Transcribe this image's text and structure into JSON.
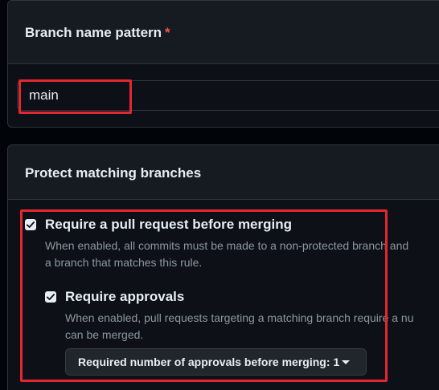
{
  "branch_name_section": {
    "title": "Branch name pattern",
    "required_marker": "*",
    "input_value": "main"
  },
  "protect_section": {
    "title": "Protect matching branches",
    "options": [
      {
        "label": "Require a pull request before merging",
        "checked": true,
        "description_line1": "When enabled, all commits must be made to a non-protected branch and",
        "description_line2": "a branch that matches this rule."
      },
      {
        "label": "Require approvals",
        "checked": true,
        "description_line1": "When enabled, pull requests targeting a matching branch require a nu",
        "description_line2": "can be merged."
      }
    ],
    "approvals_dropdown": {
      "label": "Required number of approvals before merging:",
      "value": "1",
      "icon": "triangle-down-icon"
    }
  },
  "colors": {
    "page_bg": "#010409",
    "box_bg": "#0d1117",
    "header_bg": "#161b22",
    "border": "#30363d",
    "text": "#e6edf3",
    "muted_text": "#8d96a0",
    "required": "#f85149",
    "highlight": "#e3262f"
  }
}
